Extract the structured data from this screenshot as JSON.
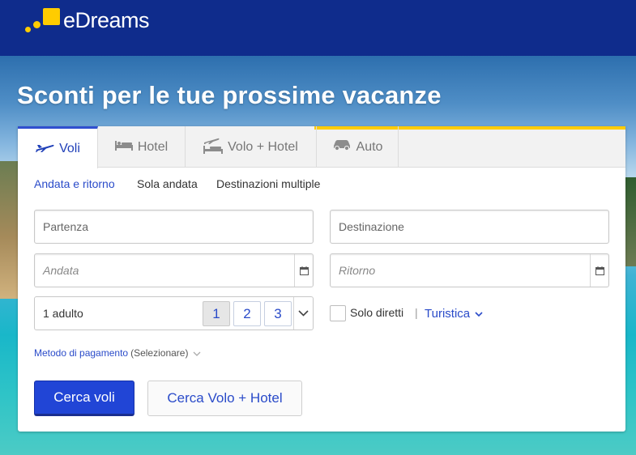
{
  "brand": {
    "name": "eDreams",
    "accent": "#ffcc00",
    "header_bg": "#0f2c8c"
  },
  "hero": {
    "headline": "Sconti per le tue prossime vacanze"
  },
  "tabs": [
    {
      "label": "Voli",
      "icon": "plane-icon",
      "active": true
    },
    {
      "label": "Hotel",
      "icon": "bed-icon",
      "active": false
    },
    {
      "label": "Volo + Hotel",
      "icon": "plane-bed-icon",
      "active": false
    },
    {
      "label": "Auto",
      "icon": "car-icon",
      "active": false
    }
  ],
  "trip_types": [
    {
      "label": "Andata e ritorno",
      "active": true
    },
    {
      "label": "Sola andata",
      "active": false
    },
    {
      "label": "Destinazioni multiple",
      "active": false
    }
  ],
  "fields": {
    "departure_placeholder": "Partenza",
    "destination_placeholder": "Destinazione",
    "outbound_placeholder": "Andata",
    "return_placeholder": "Ritorno"
  },
  "passengers": {
    "label": "1 adulto",
    "options": [
      "1",
      "2",
      "3"
    ],
    "selected": "1"
  },
  "direct_only": {
    "label": "Solo diretti",
    "checked": false,
    "separator": "|"
  },
  "cabin_class": {
    "value": "Turistica"
  },
  "payment": {
    "link": "Metodo di pagamento",
    "note": "(Selezionare)"
  },
  "buttons": {
    "search_flights": "Cerca voli",
    "search_flight_hotel": "Cerca Volo + Hotel"
  },
  "colors": {
    "primary_button": "#2145d6",
    "link": "#2a4bc9"
  }
}
